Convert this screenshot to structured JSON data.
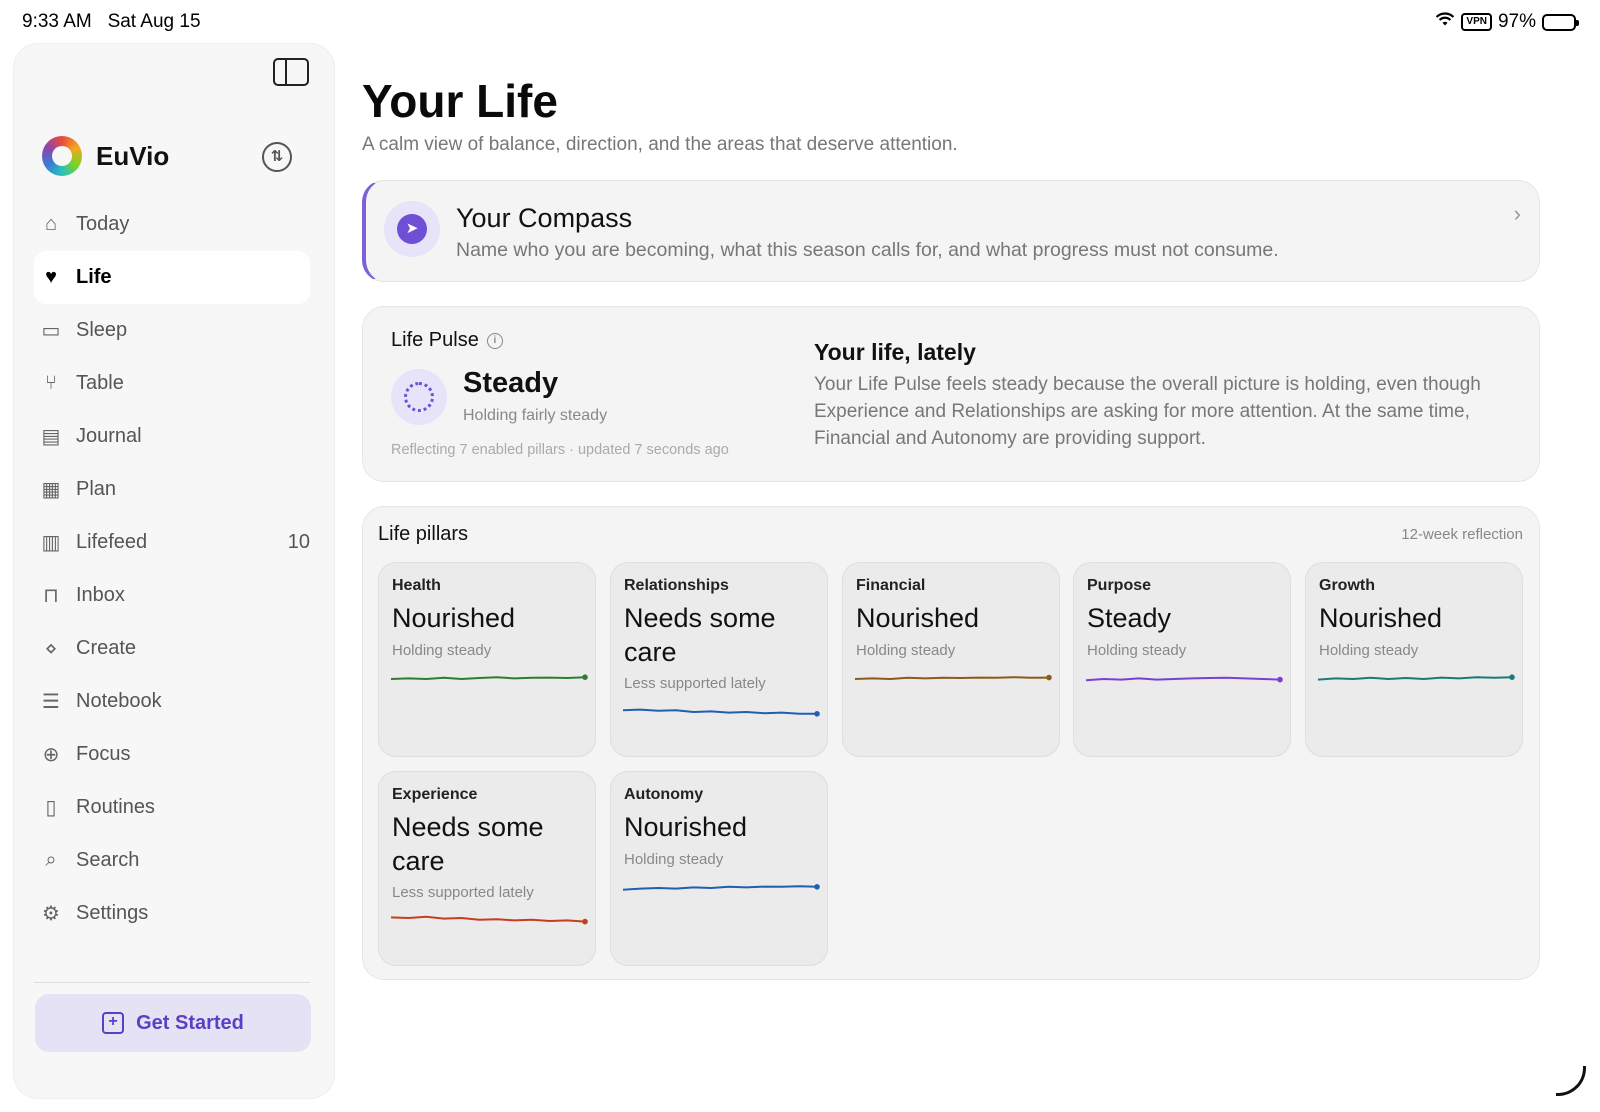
{
  "status_bar": {
    "time": "9:33 AM",
    "date": "Sat Aug 15",
    "vpn": "VPN",
    "battery": "97%"
  },
  "sidebar": {
    "brand": "EuVio",
    "items": [
      {
        "label": "Today",
        "icon": "house-icon"
      },
      {
        "label": "Life",
        "icon": "heart-icon",
        "active": true
      },
      {
        "label": "Sleep",
        "icon": "bed-icon"
      },
      {
        "label": "Table",
        "icon": "fork-knife-icon"
      },
      {
        "label": "Journal",
        "icon": "journal-icon"
      },
      {
        "label": "Plan",
        "icon": "calendar-icon"
      },
      {
        "label": "Lifefeed",
        "icon": "newspaper-icon",
        "badge": "10"
      },
      {
        "label": "Inbox",
        "icon": "tray-icon"
      },
      {
        "label": "Create",
        "icon": "nodes-icon"
      },
      {
        "label": "Notebook",
        "icon": "notebook-icon"
      },
      {
        "label": "Focus",
        "icon": "crosshair-icon"
      },
      {
        "label": "Routines",
        "icon": "checklist-icon"
      },
      {
        "label": "Search",
        "icon": "search-icon"
      },
      {
        "label": "Settings",
        "icon": "gear-icon"
      }
    ],
    "cta": "Get Started"
  },
  "main": {
    "title": "Your Life",
    "subtitle": "A calm view of balance, direction, and the areas that deserve attention.",
    "compass": {
      "title": "Your Compass",
      "description": "Name who you are becoming, what this season calls for, and what progress must not consume."
    },
    "pulse": {
      "label": "Life Pulse",
      "status": "Steady",
      "status_sub": "Holding fairly steady",
      "meta": "Reflecting 7 enabled pillars · updated 7 seconds ago",
      "lately_title": "Your life, lately",
      "lately_text": "Your Life Pulse feels steady because the overall picture is holding, even though Experience and Relationships are asking for more attention. At the same time, Financial and Autonomy are providing support."
    },
    "pillars": {
      "title": "Life pillars",
      "note": "12-week reflection",
      "items": [
        {
          "name": "Health",
          "status": "Nourished",
          "sub": "Holding steady",
          "color": "#2e7d32",
          "trend": [
            0.5,
            0.45,
            0.5,
            0.4,
            0.5,
            0.42,
            0.35,
            0.45,
            0.4,
            0.38,
            0.42,
            0.35
          ]
        },
        {
          "name": "Relationships",
          "status": "Needs some care",
          "sub": "Less supported lately",
          "color": "#1f5fb4",
          "trend": [
            0.35,
            0.3,
            0.4,
            0.35,
            0.5,
            0.45,
            0.55,
            0.5,
            0.6,
            0.55,
            0.65,
            0.65
          ]
        },
        {
          "name": "Financial",
          "status": "Nourished",
          "sub": "Holding steady",
          "color": "#8b5a1a",
          "trend": [
            0.5,
            0.45,
            0.5,
            0.4,
            0.45,
            0.4,
            0.42,
            0.38,
            0.4,
            0.35,
            0.4,
            0.38
          ]
        },
        {
          "name": "Purpose",
          "status": "Steady",
          "sub": "Holding steady",
          "color": "#7b3fd6",
          "trend": [
            0.6,
            0.5,
            0.55,
            0.45,
            0.55,
            0.5,
            0.45,
            0.42,
            0.4,
            0.45,
            0.5,
            0.55
          ]
        },
        {
          "name": "Growth",
          "status": "Nourished",
          "sub": "Holding steady",
          "color": "#1b7a78",
          "trend": [
            0.55,
            0.45,
            0.5,
            0.4,
            0.5,
            0.42,
            0.5,
            0.38,
            0.45,
            0.35,
            0.4,
            0.35
          ]
        },
        {
          "name": "Experience",
          "status": "Needs some care",
          "sub": "Less supported lately",
          "color": "#c2401a",
          "trend": [
            0.2,
            0.25,
            0.15,
            0.3,
            0.25,
            0.4,
            0.35,
            0.45,
            0.4,
            0.5,
            0.45,
            0.55
          ]
        },
        {
          "name": "Autonomy",
          "status": "Nourished",
          "sub": "Holding steady",
          "color": "#1f5fb4",
          "trend": [
            0.65,
            0.55,
            0.5,
            0.55,
            0.45,
            0.5,
            0.4,
            0.45,
            0.38,
            0.4,
            0.35,
            0.4
          ]
        }
      ]
    }
  }
}
